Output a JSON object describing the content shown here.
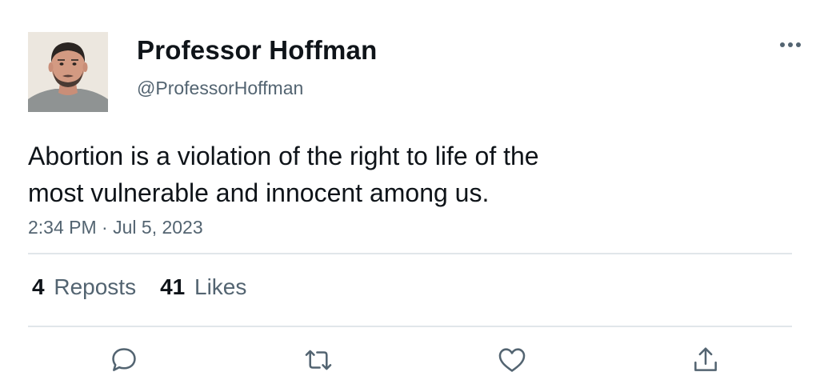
{
  "author": {
    "display_name": "Professor Hoffman",
    "handle": "@ProfessorHoffman"
  },
  "tweet": {
    "text_line1": "Abortion is a violation of the right to life of the",
    "text_line2": "most vulnerable and innocent among us.",
    "time": "2:34 PM",
    "separator": "·",
    "date": "Jul 5, 2023"
  },
  "stats": {
    "reposts_count": "4",
    "reposts_label": "Reposts",
    "likes_count": "41",
    "likes_label": "Likes"
  },
  "icons": {
    "more": "more-horizontal-icon",
    "reply": "reply-icon",
    "repost": "repost-icon",
    "like": "heart-icon",
    "share": "share-icon"
  },
  "colors": {
    "text": "#0f1419",
    "secondary": "#536471",
    "divider": "#e1e6ea"
  }
}
